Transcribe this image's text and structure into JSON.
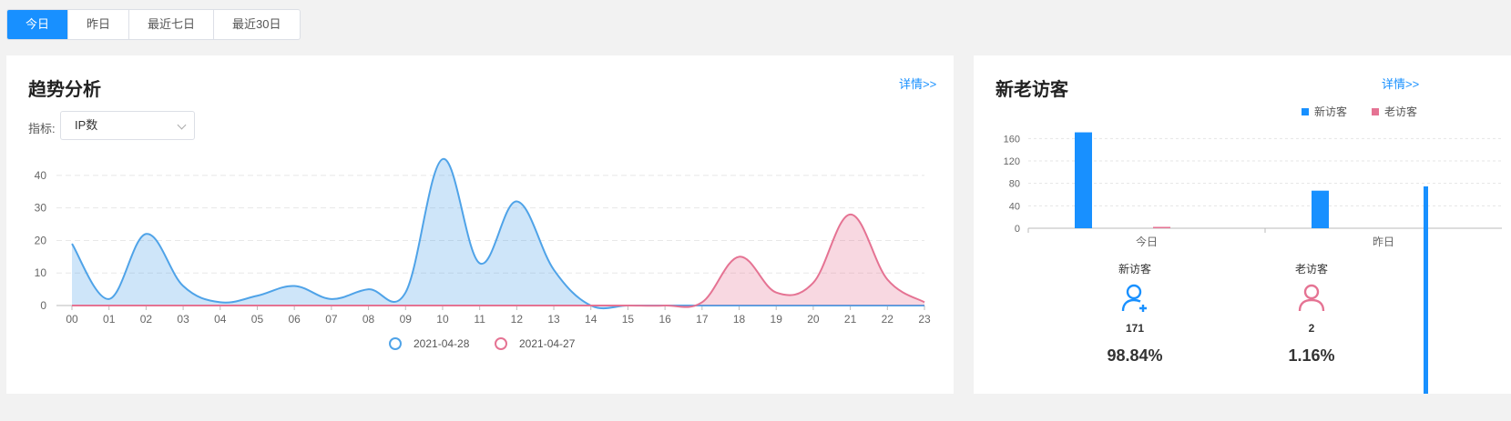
{
  "tabs": [
    {
      "label": "今日",
      "active": true
    },
    {
      "label": "昨日",
      "active": false
    },
    {
      "label": "最近七日",
      "active": false
    },
    {
      "label": "最近30日",
      "active": false
    }
  ],
  "trend": {
    "title": "趋势分析",
    "detail_label": "详情>>",
    "indicator_label": "指标:",
    "indicator_value": "IP数"
  },
  "visitors": {
    "title": "新老访客",
    "detail_label": "详情>>",
    "new": {
      "label": "新访客",
      "count": "171",
      "percent": "98.84%",
      "icon": "user-add-icon"
    },
    "old": {
      "label": "老访客",
      "count": "2",
      "percent": "1.16%",
      "icon": "user-icon"
    }
  },
  "chart_data": [
    {
      "type": "area",
      "x": [
        "00",
        "01",
        "02",
        "03",
        "04",
        "05",
        "06",
        "07",
        "08",
        "09",
        "10",
        "11",
        "12",
        "13",
        "14",
        "15",
        "16",
        "17",
        "18",
        "19",
        "20",
        "21",
        "22",
        "23"
      ],
      "ylim": [
        0,
        45
      ],
      "yticks": [
        0,
        10,
        20,
        30,
        40
      ],
      "grid": true,
      "legend_position": "bottom",
      "series": [
        {
          "name": "2021-04-28",
          "color": "#4fa3e8",
          "values": [
            19,
            2,
            22,
            6,
            1,
            3,
            6,
            2,
            5,
            4,
            45,
            13,
            32,
            11,
            0,
            0,
            0,
            0,
            0,
            0,
            0,
            0,
            0,
            0
          ]
        },
        {
          "name": "2021-04-27",
          "color": "#e57393",
          "values": [
            0,
            0,
            0,
            0,
            0,
            0,
            0,
            0,
            0,
            0,
            0,
            0,
            0,
            0,
            0,
            0,
            0,
            1,
            15,
            4,
            7,
            28,
            8,
            1
          ]
        }
      ]
    },
    {
      "type": "bar",
      "categories": [
        "今日",
        "昨日"
      ],
      "ylim": [
        0,
        180
      ],
      "yticks": [
        0,
        40,
        80,
        120,
        160
      ],
      "grid": true,
      "legend_position": "top-right",
      "series": [
        {
          "name": "新访客",
          "color": "#1890ff",
          "values": [
            171,
            67
          ]
        },
        {
          "name": "老访客",
          "color": "#e57393",
          "values": [
            2,
            0
          ]
        }
      ]
    }
  ]
}
